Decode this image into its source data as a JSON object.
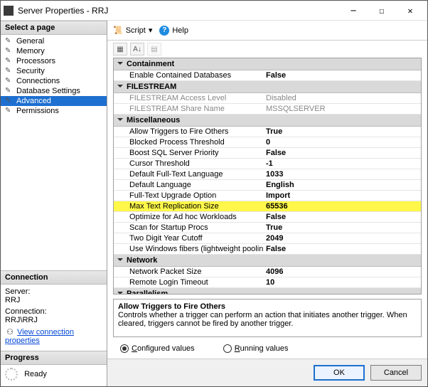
{
  "window": {
    "title": "Server Properties - RRJ"
  },
  "toolbar": {
    "script_label": "Script",
    "help_label": "Help"
  },
  "sidebar": {
    "header": "Select a page",
    "items": [
      {
        "label": "General"
      },
      {
        "label": "Memory"
      },
      {
        "label": "Processors"
      },
      {
        "label": "Security"
      },
      {
        "label": "Connections"
      },
      {
        "label": "Database Settings"
      },
      {
        "label": "Advanced"
      },
      {
        "label": "Permissions"
      }
    ],
    "selected_index": 6
  },
  "connection": {
    "header": "Connection",
    "server_label": "Server:",
    "server_value": "RRJ",
    "conn_label": "Connection:",
    "conn_value": "RRJ\\RRJ",
    "view_props": "View connection properties"
  },
  "progress": {
    "header": "Progress",
    "status": "Ready"
  },
  "grid": {
    "categories": [
      {
        "name": "Containment",
        "rows": [
          {
            "k": "Enable Contained Databases",
            "v": "False"
          }
        ]
      },
      {
        "name": "FILESTREAM",
        "rows": [
          {
            "k": "FILESTREAM Access Level",
            "v": "Disabled",
            "disabled": true
          },
          {
            "k": "FILESTREAM Share Name",
            "v": "MSSQLSERVER",
            "disabled": true
          }
        ]
      },
      {
        "name": "Miscellaneous",
        "rows": [
          {
            "k": "Allow Triggers to Fire Others",
            "v": "True"
          },
          {
            "k": "Blocked Process Threshold",
            "v": "0"
          },
          {
            "k": "Boost SQL Server Priority",
            "v": "False"
          },
          {
            "k": "Cursor Threshold",
            "v": "-1"
          },
          {
            "k": "Default Full-Text Language",
            "v": "1033"
          },
          {
            "k": "Default Language",
            "v": "English"
          },
          {
            "k": "Full-Text Upgrade Option",
            "v": "Import"
          },
          {
            "k": "Max Text Replication Size",
            "v": "65536",
            "highlight": true
          },
          {
            "k": "Optimize for Ad hoc Workloads",
            "v": "False"
          },
          {
            "k": "Scan for Startup Procs",
            "v": "True"
          },
          {
            "k": "Two Digit Year Cutoff",
            "v": "2049"
          },
          {
            "k": "Use Windows fibers (lightweight pooling)",
            "v": "False"
          }
        ]
      },
      {
        "name": "Network",
        "rows": [
          {
            "k": "Network Packet Size",
            "v": "4096"
          },
          {
            "k": "Remote Login Timeout",
            "v": "10"
          }
        ]
      },
      {
        "name": "Parallelism",
        "rows": []
      }
    ]
  },
  "description": {
    "title": "Allow Triggers to Fire Others",
    "text": "Controls whether a trigger can perform an action that initiates another trigger. When cleared, triggers cannot be fired by another trigger."
  },
  "radios": {
    "configured": "Configured values",
    "running": "Running values",
    "selected": "configured"
  },
  "buttons": {
    "ok": "OK",
    "cancel": "Cancel"
  }
}
